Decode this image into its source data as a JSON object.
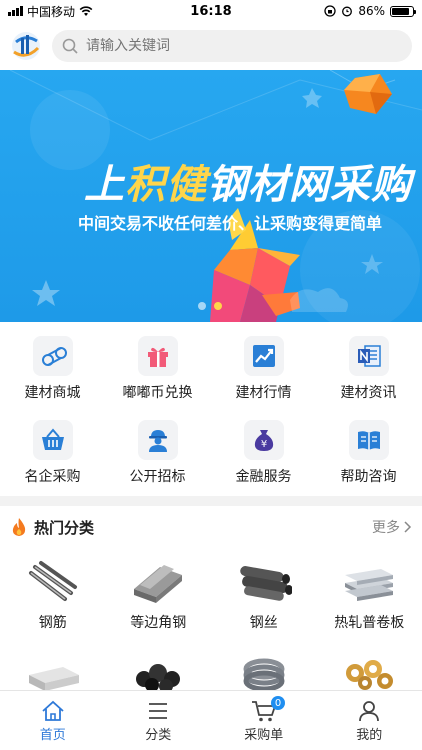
{
  "status_bar": {
    "carrier": "中国移动",
    "time": "16:18",
    "battery": "86%",
    "battery_level": 0.86
  },
  "header": {
    "search_placeholder": "请输入关键词"
  },
  "banner": {
    "title_part1": "上",
    "title_part2": "积健",
    "title_part3": "钢材网采购",
    "subtitle": "中间交易不收任何差价、让采购变得更简单",
    "slides_count": 2,
    "active_slide": 2
  },
  "quick_menu": {
    "items": [
      {
        "label": "建材商城",
        "icon": "steel-pipe-icon"
      },
      {
        "label": "嘟嘟币兑换",
        "icon": "gift-icon"
      },
      {
        "label": "建材行情",
        "icon": "trend-chart-icon"
      },
      {
        "label": "建材资讯",
        "icon": "news-icon"
      },
      {
        "label": "名企采购",
        "icon": "basket-icon"
      },
      {
        "label": "公开招标",
        "icon": "worker-icon"
      },
      {
        "label": "金融服务",
        "icon": "money-bag-icon"
      },
      {
        "label": "帮助咨询",
        "icon": "book-icon"
      }
    ]
  },
  "hot_section": {
    "title": "热门分类",
    "more": "更多"
  },
  "products": {
    "row1": [
      {
        "label": "钢筋"
      },
      {
        "label": "等边角钢"
      },
      {
        "label": "钢丝"
      },
      {
        "label": "热轧普卷板"
      }
    ]
  },
  "bottom_nav": {
    "items": [
      {
        "label": "首页"
      },
      {
        "label": "分类"
      },
      {
        "label": "采购单"
      },
      {
        "label": "我的"
      }
    ],
    "cart_badge": "0"
  },
  "colors": {
    "accent": "#2e79d8",
    "banner_blue": "#27a7f0",
    "highlight_yellow": "#ffd54a",
    "icon_blue": "#2a7fd6"
  }
}
